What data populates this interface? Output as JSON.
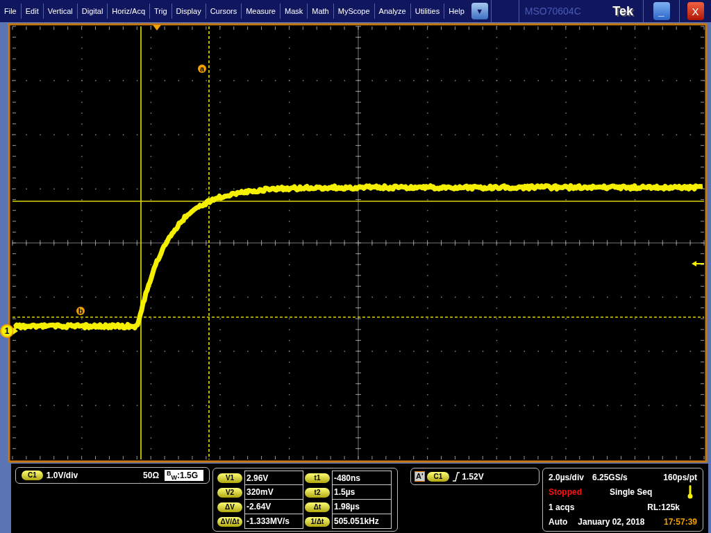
{
  "menu": {
    "items": [
      {
        "label": "File"
      },
      {
        "label": "Edit"
      },
      {
        "label": "Vertical"
      },
      {
        "label": "Digital"
      },
      {
        "label": "Horiz/Acq"
      },
      {
        "label": "Trig"
      },
      {
        "label": "Display"
      },
      {
        "label": "Cursors"
      },
      {
        "label": "Measure"
      },
      {
        "label": "Mask"
      },
      {
        "label": "Math"
      },
      {
        "label": "MyScope"
      },
      {
        "label": "Analyze"
      },
      {
        "label": "Utilities"
      },
      {
        "label": "Help"
      }
    ],
    "dropdown": "▼"
  },
  "title_bar": {
    "model": "MSO70604C",
    "brand": "Tek",
    "minimize": "_",
    "close": "X"
  },
  "display": {
    "channel_marker": "1",
    "cursor_labels": [
      "a",
      "b"
    ]
  },
  "channel": {
    "badge": "C1",
    "scale": "1.0V/div",
    "impedance": "50Ω",
    "bandwidth": "$^{B}$$_{W}$:1.5G"
  },
  "cursors": {
    "left": [
      {
        "label": "V1",
        "value": "2.96V"
      },
      {
        "label": "V2",
        "value": "320mV"
      },
      {
        "label": "ΔV",
        "value": "-2.64V"
      },
      {
        "label": "ΔV/Δt",
        "value": "-1.333MV/s"
      }
    ],
    "right": [
      {
        "label": "t1",
        "value": "-480ns"
      },
      {
        "label": "t2",
        "value": "1.5µs"
      },
      {
        "label": "Δt",
        "value": "1.98µs"
      },
      {
        "label": "1/Δt",
        "value": "505.051kHz"
      }
    ]
  },
  "trigger": {
    "marker": "A'",
    "source": "C1",
    "level": "1.52V"
  },
  "acquisition": {
    "horizontal_scale": "2.0µs/div",
    "sample_rate": "6.25GS/s",
    "resolution": "160ps/pt",
    "state": "Stopped",
    "mode": "Single Seq",
    "acquisitions": "1 acqs",
    "record_length": "RL:125k",
    "trigger_mode": "Auto",
    "date": "January 02, 2018",
    "time": "17:57:39"
  }
}
